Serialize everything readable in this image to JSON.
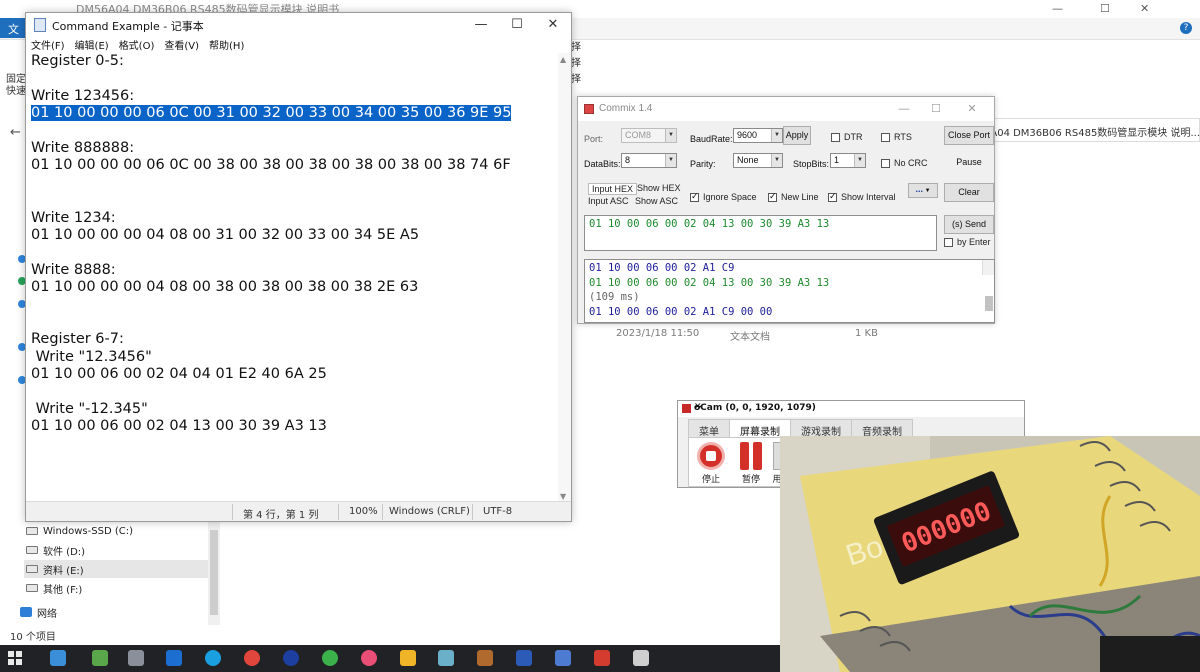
{
  "explorer": {
    "title": "DM56A04 DM36B06 RS485数码管显示模块 说明书",
    "file_tab": "文件",
    "left_labels": [
      "固定",
      "快速"
    ],
    "address_text": "6A04 DM36B06 RS485数码管显示模块 说明...",
    "file_date": "2023/1/18 11:50",
    "file_type": "文本文档",
    "file_size": "1 KB",
    "drives": [
      "Windows-SSD (C:)",
      "软件 (D:)",
      "资料 (E:)",
      "其他 (F:)"
    ],
    "network": "网络",
    "item_count": "10 个项目",
    "strip": [
      "择",
      "择",
      "择"
    ]
  },
  "notepad": {
    "title": "Command Example - 记事本",
    "menu": [
      "文件(F)",
      "编辑(E)",
      "格式(O)",
      "查看(V)",
      "帮助(H)"
    ],
    "lines": [
      "Register 0-5:",
      "",
      "Write 123456:",
      "01 10 00 00 00 06 0C 00 31 00 32 00 33 00 34 00 35 00 36 9E 95",
      "",
      "Write 888888:",
      "01 10 00 00 00 06 0C 00 38 00 38 00 38 00 38 00 38 00 38 74 6F",
      "",
      "",
      "Write 1234:",
      "01 10 00 00 00 04 08 00 31 00 32 00 33 00 34 5E A5",
      "",
      "Write 8888:",
      "01 10 00 00 00 04 08 00 38 00 38 00 38 00 38 2E 63",
      "",
      "",
      "Register 6-7:",
      " Write \"12.3456\"",
      "01 10 00 06 00 02 04 04 01 E2 40 6A 25",
      "",
      " Write \"-12.345\"",
      "01 10 00 06 00 02 04 13 00 30 39 A3 13"
    ],
    "selected_line": 3,
    "status": {
      "position": "第 4 行，第 1 列",
      "zoom": "100%",
      "line_ending": "Windows (CRLF)",
      "encoding": "UTF-8"
    }
  },
  "commix": {
    "title": "Commix 1.4",
    "port_label": "Port:",
    "port_value": "COM8",
    "baud_label": "BaudRate:",
    "baud_value": "9600",
    "apply": "Apply",
    "dtr": "DTR",
    "rts": "RTS",
    "close_port": "Close Port",
    "databits_label": "DataBits:",
    "databits_value": "8",
    "parity_label": "Parity:",
    "parity_value": "None",
    "stopbits_label": "StopBits:",
    "stopbits_value": "1",
    "no_crc": "No CRC",
    "pause": "Pause",
    "input_hex": "Input HEX",
    "show_hex": "Show HEX",
    "input_asc": "Input ASC",
    "show_asc": "Show ASC",
    "ignore_space": "Ignore Space",
    "new_line": "New Line",
    "show_interval": "Show Interval",
    "more": "...",
    "clear": "Clear",
    "send_text": "01 10 00 06 00 02 04 13 00 30 39 A3 13",
    "send": "Send",
    "send_prefix": "(s)",
    "by_enter": "by Enter",
    "received": [
      {
        "text": "01 10 00 06 00 02 A1 C9",
        "kind": "rx"
      },
      {
        "text": "01 10 00 06 00 02 04 13 00 30 39 A3 13",
        "kind": "tx"
      },
      {
        "text": "(109 ms)",
        "kind": "ms"
      },
      {
        "text": "01 10 00 06 00 02 A1 C9 00 00",
        "kind": "rx"
      }
    ]
  },
  "ocam": {
    "title": "oCam (0, 0, 1920, 1079)",
    "tabs": [
      "菜单",
      "屏幕录制",
      "游戏录制",
      "音频录制"
    ],
    "stop": "停止",
    "pause": "暂停",
    "partial": "用"
  },
  "photo": {
    "display_digits": "000000",
    "notebook_text": "Bo    te"
  },
  "colors": {
    "selection": "#0a64c8",
    "tx_green": "#1f8a2c",
    "rx_blue": "#1e1e9a",
    "record_red": "#d4302a",
    "led_red": "#ff5a5a"
  }
}
